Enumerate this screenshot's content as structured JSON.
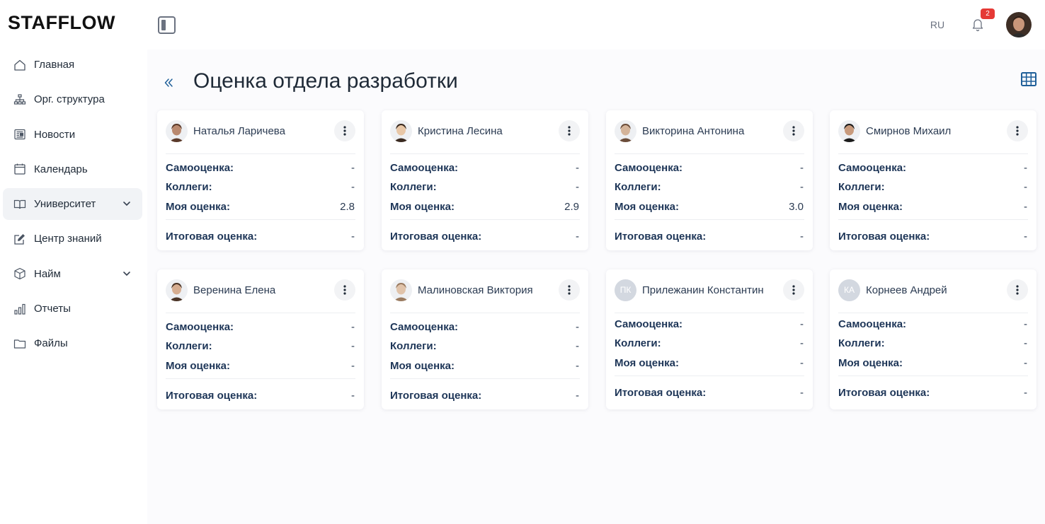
{
  "app": {
    "logo": "STAFFLOW"
  },
  "sidebar": {
    "items": [
      {
        "label": "Главная",
        "icon": "home-icon"
      },
      {
        "label": "Орг. структура",
        "icon": "org-structure-icon"
      },
      {
        "label": "Новости",
        "icon": "news-icon"
      },
      {
        "label": "Календарь",
        "icon": "calendar-icon"
      },
      {
        "label": "Университет",
        "icon": "book-icon",
        "active": true,
        "expandable": true
      },
      {
        "label": "Центр знаний",
        "icon": "edit-icon"
      },
      {
        "label": "Найм",
        "icon": "box-icon",
        "expandable": true
      },
      {
        "label": "Отчеты",
        "icon": "bar-chart-icon"
      },
      {
        "label": "Файлы",
        "icon": "folder-icon"
      }
    ]
  },
  "topbar": {
    "language": "RU",
    "notifications_count": "2"
  },
  "page": {
    "title": "Оценка отдела разработки"
  },
  "labels": {
    "self": "Самооценка:",
    "colleagues": "Коллеги:",
    "mine": "Моя оценка:",
    "final": "Итоговая оценка:"
  },
  "cards": [
    {
      "name": "Наталья Ларичева",
      "avatar": "photo",
      "self": "-",
      "colleagues": "-",
      "mine": "2.8",
      "final": "-"
    },
    {
      "name": "Кристина Лесина",
      "avatar": "photo",
      "self": "-",
      "colleagues": "-",
      "mine": "2.9",
      "final": "-"
    },
    {
      "name": "Викторина Антонина",
      "avatar": "photo",
      "self": "-",
      "colleagues": "-",
      "mine": "3.0",
      "final": "-"
    },
    {
      "name": "Смирнов Михаил",
      "avatar": "photo",
      "self": "-",
      "colleagues": "-",
      "mine": "-",
      "final": "-"
    },
    {
      "name": "Веренина Елена",
      "avatar": "photo",
      "self": "-",
      "colleagues": "-",
      "mine": "-",
      "final": "-"
    },
    {
      "name": "Малиновская Виктория",
      "avatar": "photo",
      "self": "-",
      "colleagues": "-",
      "mine": "-",
      "final": "-"
    },
    {
      "name": "Прилежанин Константин",
      "avatar": "initials",
      "initials": "ПК",
      "self": "-",
      "colleagues": "-",
      "mine": "-",
      "final": "-"
    },
    {
      "name": "Корнеев Андрей",
      "avatar": "initials",
      "initials": "КА",
      "self": "-",
      "colleagues": "-",
      "mine": "-",
      "final": "-"
    }
  ],
  "colors": {
    "accent_blue": "#1f5f99",
    "text_dark": "#1d3557",
    "badge_red": "#e53935",
    "active_bg": "#f1f3f6"
  }
}
